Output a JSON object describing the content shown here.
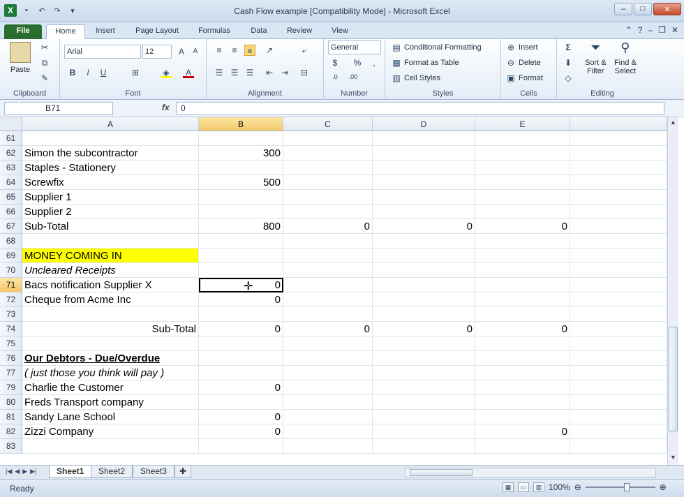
{
  "window": {
    "title": "Cash Flow example  [Compatibility Mode]  -  Microsoft Excel"
  },
  "tabs": [
    "File",
    "Home",
    "Insert",
    "Page Layout",
    "Formulas",
    "Data",
    "Review",
    "View"
  ],
  "ribbon": {
    "clipboard": {
      "paste": "Paste",
      "label": "Clipboard"
    },
    "font": {
      "name": "Arial",
      "size": "12",
      "label": "Font"
    },
    "alignment": {
      "label": "Alignment"
    },
    "number": {
      "format": "General",
      "label": "Number"
    },
    "styles": {
      "conditional": "Conditional Formatting",
      "format_table": "Format as Table",
      "cell_styles": "Cell Styles",
      "label": "Styles"
    },
    "cells": {
      "insert": "Insert",
      "delete": "Delete",
      "format": "Format",
      "label": "Cells"
    },
    "editing": {
      "sort": "Sort &",
      "filter": "Filter",
      "find": "Find &",
      "select": "Select",
      "label": "Editing"
    }
  },
  "formula_bar": {
    "name_box": "B71",
    "fx": "fx",
    "content": "0"
  },
  "columns": [
    "A",
    "B",
    "C",
    "D",
    "E"
  ],
  "rows": [
    {
      "n": "61",
      "a": "",
      "b": "",
      "c": "",
      "d": "",
      "e": ""
    },
    {
      "n": "62",
      "a": "Simon the subcontractor",
      "b": "300",
      "c": "",
      "d": "",
      "e": ""
    },
    {
      "n": "63",
      "a": "Staples - Stationery",
      "b": "",
      "c": "",
      "d": "",
      "e": ""
    },
    {
      "n": "64",
      "a": "Screwfix",
      "b": "500",
      "c": "",
      "d": "",
      "e": ""
    },
    {
      "n": "65",
      "a": "Supplier 1",
      "b": "",
      "c": "",
      "d": "",
      "e": ""
    },
    {
      "n": "66",
      "a": "Supplier 2",
      "b": "",
      "c": "",
      "d": "",
      "e": ""
    },
    {
      "n": "67",
      "a": "Sub-Total",
      "b": "800",
      "c": "0",
      "d": "0",
      "e": "0"
    },
    {
      "n": "68",
      "a": "",
      "b": "",
      "c": "",
      "d": "",
      "e": ""
    },
    {
      "n": "69",
      "a": "MONEY COMING IN",
      "b": "",
      "c": "",
      "d": "",
      "e": "",
      "style": "yellow"
    },
    {
      "n": "70",
      "a": "Uncleared Receipts",
      "b": "",
      "c": "",
      "d": "",
      "e": "",
      "style": "ital"
    },
    {
      "n": "71",
      "a": "Bacs notification Supplier X",
      "b": "0",
      "c": "",
      "d": "",
      "e": ""
    },
    {
      "n": "72",
      "a": "Cheque from  Acme Inc",
      "b": "0",
      "c": "",
      "d": "",
      "e": ""
    },
    {
      "n": "73",
      "a": "",
      "b": "",
      "c": "",
      "d": "",
      "e": ""
    },
    {
      "n": "74",
      "a": "Sub-Total",
      "b": "0",
      "c": "0",
      "d": "0",
      "e": "0",
      "style": "right"
    },
    {
      "n": "75",
      "a": "",
      "b": "",
      "c": "",
      "d": "",
      "e": ""
    },
    {
      "n": "76",
      "a": "Our Debtors - Due/Overdue",
      "b": "",
      "c": "",
      "d": "",
      "e": "",
      "style": "bu"
    },
    {
      "n": "77",
      "a": "( just those you think will pay )",
      "b": "",
      "c": "",
      "d": "",
      "e": "",
      "style": "ital"
    },
    {
      "n": "79",
      "a": "Charlie the Customer",
      "b": "0",
      "c": "",
      "d": "",
      "e": ""
    },
    {
      "n": "80",
      "a": "Freds Transport company",
      "b": "",
      "c": "",
      "d": "",
      "e": ""
    },
    {
      "n": "81",
      "a": "Sandy Lane School",
      "b": "0",
      "c": "",
      "d": "",
      "e": ""
    },
    {
      "n": "82",
      "a": "Zizzi Company",
      "b": "0",
      "c": "",
      "d": "",
      "e": "0"
    },
    {
      "n": "83",
      "a": "",
      "b": "",
      "c": "",
      "d": "",
      "e": ""
    }
  ],
  "sheets": [
    "Sheet1",
    "Sheet2",
    "Sheet3"
  ],
  "status": {
    "ready": "Ready",
    "zoom": "100%"
  }
}
